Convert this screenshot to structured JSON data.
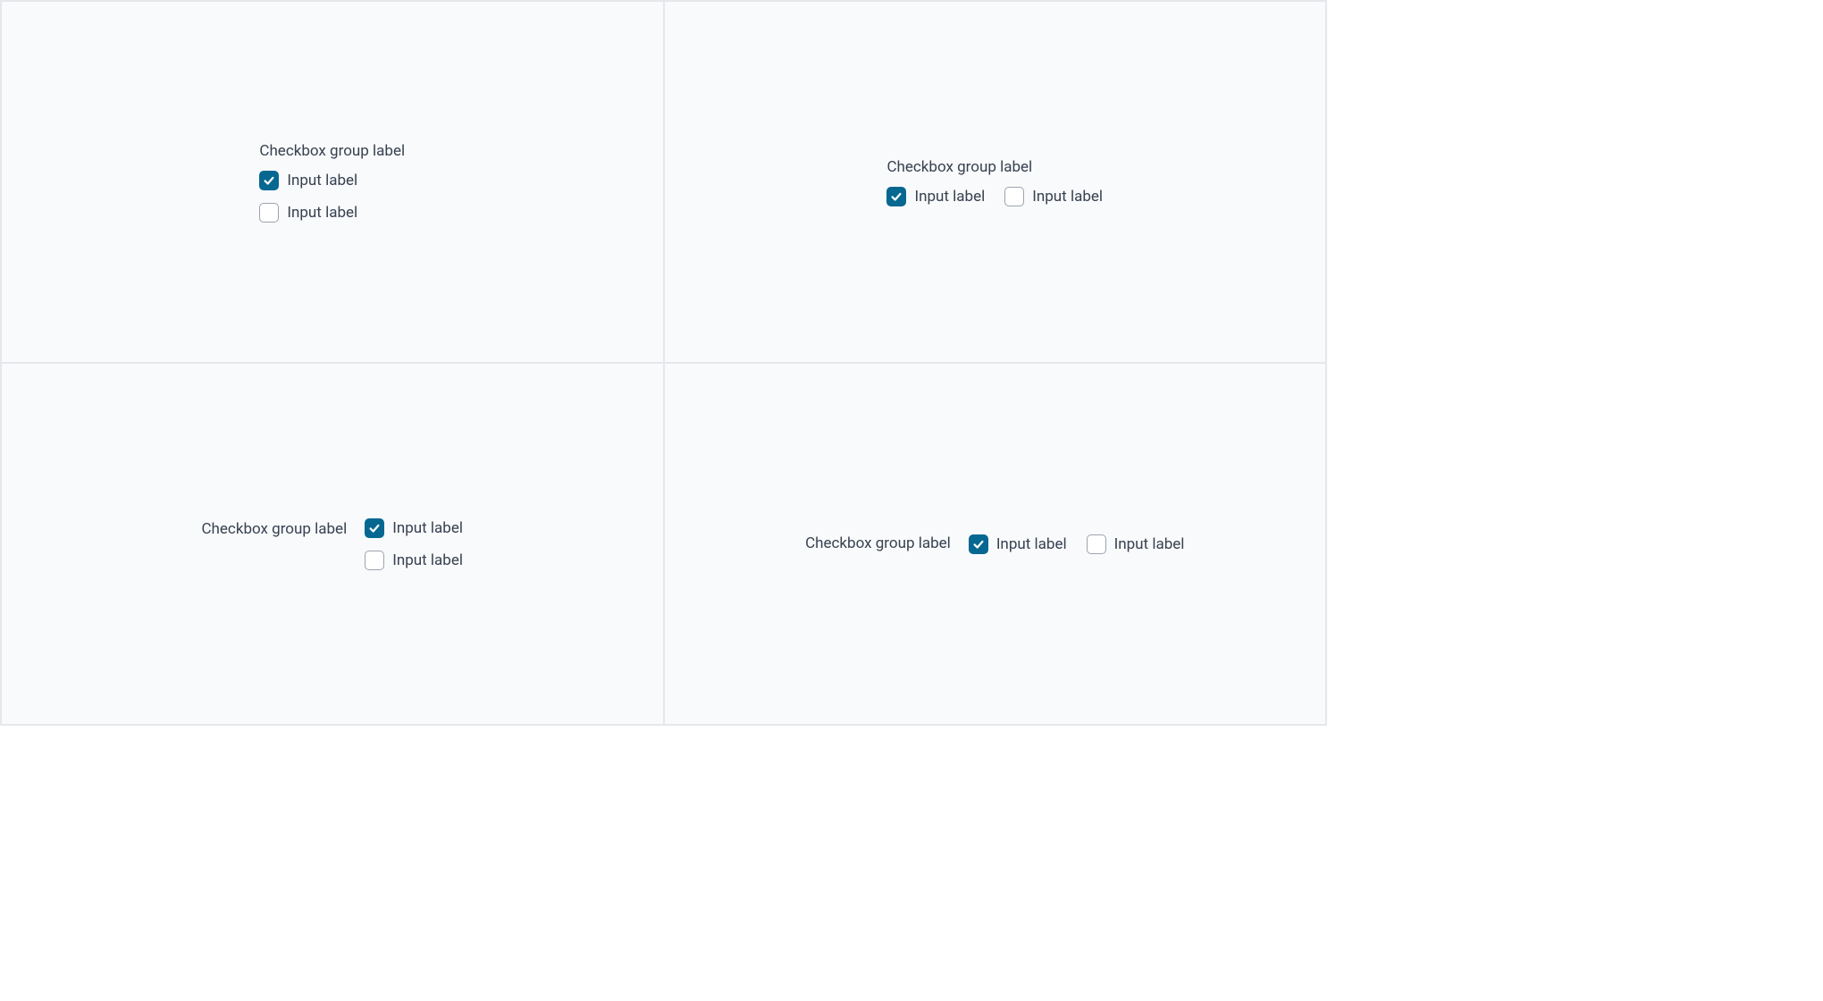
{
  "colors": {
    "accent": "#066891",
    "text": "#374151",
    "border": "#e5e7eb",
    "panel": "#f9fafb"
  },
  "quadrants": {
    "q1": {
      "group_label": "Checkbox group label",
      "items": [
        {
          "label": "Input label",
          "checked": true
        },
        {
          "label": "Input label",
          "checked": false
        }
      ]
    },
    "q2": {
      "group_label": "Checkbox group label",
      "items": [
        {
          "label": "Input label",
          "checked": true
        },
        {
          "label": "Input label",
          "checked": false
        }
      ]
    },
    "q3": {
      "group_label": "Checkbox group label",
      "items": [
        {
          "label": "Input label",
          "checked": true
        },
        {
          "label": "Input label",
          "checked": false
        }
      ]
    },
    "q4": {
      "group_label": "Checkbox group label",
      "items": [
        {
          "label": "Input label",
          "checked": true
        },
        {
          "label": "Input label",
          "checked": false
        }
      ]
    }
  }
}
